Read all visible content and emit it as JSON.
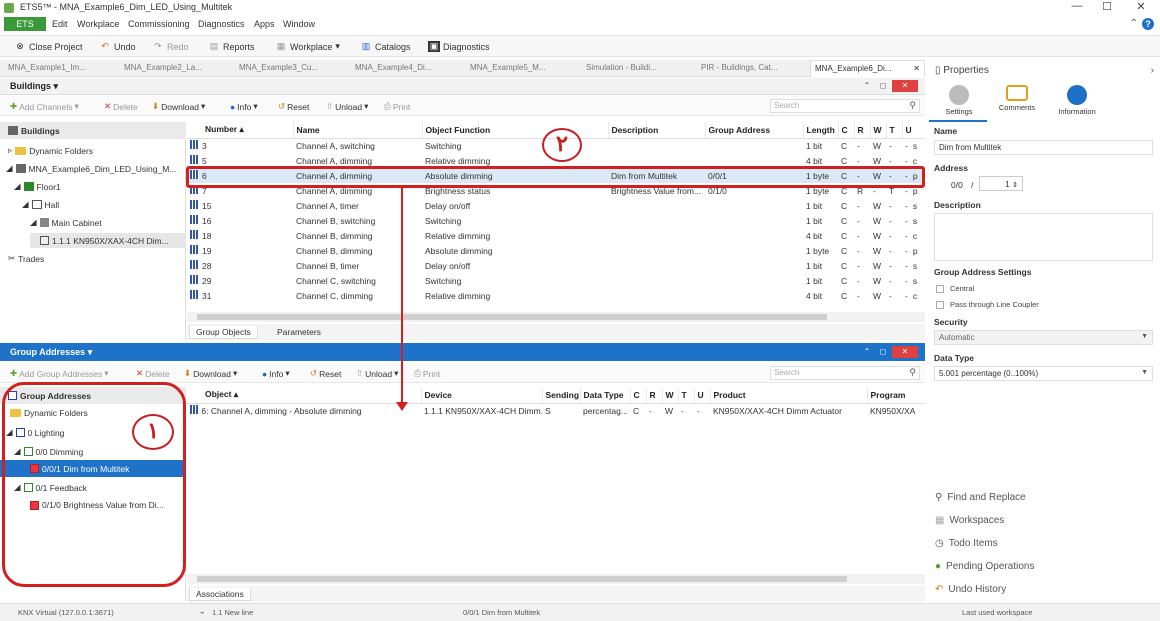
{
  "title": "ETS5™ - MNA_Example6_Dim_LED_Using_Multitek",
  "window_controls": [
    "—",
    "☐",
    "✕"
  ],
  "menu": {
    "ets": "ETS",
    "items": [
      "Edit",
      "Workplace",
      "Commissioning",
      "Diagnostics",
      "Apps",
      "Window"
    ]
  },
  "toolbar": {
    "close_project": "Close Project",
    "undo": "Undo",
    "redo": "Redo",
    "reports": "Reports",
    "workplace": "Workplace",
    "catalogs": "Catalogs",
    "diagnostics": "Diagnostics"
  },
  "doc_tabs": [
    "MNA_Example1_Im...",
    "MNA_Example2_La...",
    "MNA_Example3_Cu...",
    "MNA_Example4_Di...",
    "MNA_Example5_M...",
    "Simulation - Buildi...",
    "PIR - Buildings, Cat...",
    "MNA_Example6_Di..."
  ],
  "buildings": {
    "header": "Buildings",
    "toolbar": {
      "add_channels": "Add Channels",
      "delete": "Delete",
      "download": "Download",
      "info": "Info",
      "reset": "Reset",
      "unload": "Unload",
      "print": "Print"
    },
    "search_placeholder": "Search",
    "tree": {
      "root": "Buildings",
      "items": [
        "Dynamic Folders",
        "MNA_Example6_Dim_LED_Using_M...",
        "Floor1",
        "Hall",
        "Main Cabinet",
        "1.1.1 KN950X/XAX-4CH Dim..."
      ],
      "trades": "Trades"
    },
    "columns": [
      "Number",
      "Name",
      "Object Function",
      "Description",
      "Group Address",
      "Length",
      "C",
      "R",
      "W",
      "T",
      "U"
    ],
    "rows": [
      {
        "num": "3",
        "name": "Channel A, switching",
        "func": "Switching",
        "desc": "",
        "ga": "",
        "len": "1 bit",
        "c": "C",
        "r": "-",
        "w": "W",
        "t": "-",
        "u": "-",
        "x": "s"
      },
      {
        "num": "5",
        "name": "Channel A, dimming",
        "func": "Relative dimming",
        "desc": "",
        "ga": "",
        "len": "4 bit",
        "c": "C",
        "r": "-",
        "w": "W",
        "t": "-",
        "u": "-",
        "x": "c"
      },
      {
        "num": "6",
        "name": "Channel A, dimming",
        "func": "Absolute dimming",
        "desc": "Dim from Multitek",
        "ga": "0/0/1",
        "len": "1 byte",
        "c": "C",
        "r": "-",
        "w": "W",
        "t": "-",
        "u": "-",
        "x": "p"
      },
      {
        "num": "7",
        "name": "Channel A, dimming",
        "func": "Brightness status",
        "desc": "Brightness Value from...",
        "ga": "0/1/0",
        "len": "1 byte",
        "c": "C",
        "r": "R",
        "w": "-",
        "t": "T",
        "u": "-",
        "x": "p"
      },
      {
        "num": "15",
        "name": "Channel A, timer",
        "func": "Delay on/off",
        "desc": "",
        "ga": "",
        "len": "1 bit",
        "c": "C",
        "r": "-",
        "w": "W",
        "t": "-",
        "u": "-",
        "x": "s"
      },
      {
        "num": "16",
        "name": "Channel B, switching",
        "func": "Switching",
        "desc": "",
        "ga": "",
        "len": "1 bit",
        "c": "C",
        "r": "-",
        "w": "W",
        "t": "-",
        "u": "-",
        "x": "s"
      },
      {
        "num": "18",
        "name": "Channel B, dimming",
        "func": "Relative dimming",
        "desc": "",
        "ga": "",
        "len": "4 bit",
        "c": "C",
        "r": "-",
        "w": "W",
        "t": "-",
        "u": "-",
        "x": "c"
      },
      {
        "num": "19",
        "name": "Channel B, dimming",
        "func": "Absolute dimming",
        "desc": "",
        "ga": "",
        "len": "1 byte",
        "c": "C",
        "r": "-",
        "w": "W",
        "t": "-",
        "u": "-",
        "x": "p"
      },
      {
        "num": "28",
        "name": "Channel B, timer",
        "func": "Delay on/off",
        "desc": "",
        "ga": "",
        "len": "1 bit",
        "c": "C",
        "r": "-",
        "w": "W",
        "t": "-",
        "u": "-",
        "x": "s"
      },
      {
        "num": "29",
        "name": "Channel C, switching",
        "func": "Switching",
        "desc": "",
        "ga": "",
        "len": "1 bit",
        "c": "C",
        "r": "-",
        "w": "W",
        "t": "-",
        "u": "-",
        "x": "s"
      },
      {
        "num": "31",
        "name": "Channel C, dimming",
        "func": "Relative dimming",
        "desc": "",
        "ga": "",
        "len": "4 bit",
        "c": "C",
        "r": "-",
        "w": "W",
        "t": "-",
        "u": "-",
        "x": "c"
      }
    ],
    "bottom_tabs": [
      "Group Objects",
      "Parameters"
    ]
  },
  "group_addresses": {
    "header": "Group Addresses",
    "toolbar": {
      "add_group": "Add Group Addresses",
      "delete": "Delete",
      "download": "Download",
      "info": "Info",
      "reset": "Reset",
      "unload": "Unload",
      "print": "Print"
    },
    "search_placeholder": "Search",
    "tree": {
      "root": "Group Addresses",
      "items": [
        "Dynamic Folders",
        "0 Lighting",
        "0/0 Dimming",
        "0/0/1 Dim from Multitek",
        "0/1 Feedback",
        "0/1/0 Brightness Value from Di..."
      ]
    },
    "columns": [
      "Object",
      "Device",
      "Sending",
      "Data Type",
      "C",
      "R",
      "W",
      "T",
      "U",
      "Product",
      "Program"
    ],
    "rows": [
      {
        "object": "6: Channel A, dimming - Absolute dimming",
        "device": "1.1.1 KN950X/XAX-4CH Dimm...",
        "sending": "S",
        "dtype": "percentag...",
        "c": "C",
        "r": "-",
        "w": "W",
        "t": "-",
        "u": "-",
        "product": "KN950X/XAX-4CH Dimm Actuator",
        "program": "KN950X/XA"
      }
    ],
    "bottom_tabs": [
      "Associations"
    ]
  },
  "properties": {
    "header": "Properties",
    "tabs": [
      "Settings",
      "Comments",
      "Information"
    ],
    "name_label": "Name",
    "name_value": "Dim from Multitek",
    "address_label": "Address",
    "address_main": "0/0",
    "address_sep": "/",
    "address_sub": "1",
    "description_label": "Description",
    "ga_settings_label": "Group Address Settings",
    "central": "Central",
    "pass_through": "Pass through Line Coupler",
    "security_label": "Security",
    "security_value": "Automatic",
    "datatype_label": "Data Type",
    "datatype_value": "5.001 percentage (0..100%)"
  },
  "right_links": [
    "Find and Replace",
    "Workspaces",
    "Todo Items",
    "Pending Operations",
    "Undo History"
  ],
  "status": {
    "left": "KNX Virtual (127.0.0.1:3671)",
    "mid1": "1.1 New line",
    "mid2": "0/0/1 Dim from Multitek",
    "right": "Last used workspace"
  },
  "annotations": {
    "one": "١",
    "two": "٢"
  },
  "colors": {
    "ets_green": "#3a9a3a",
    "ga_header_blue": "#1e72c8",
    "selection_blue": "#1e72c8",
    "annotation_red": "#c91c1c"
  }
}
